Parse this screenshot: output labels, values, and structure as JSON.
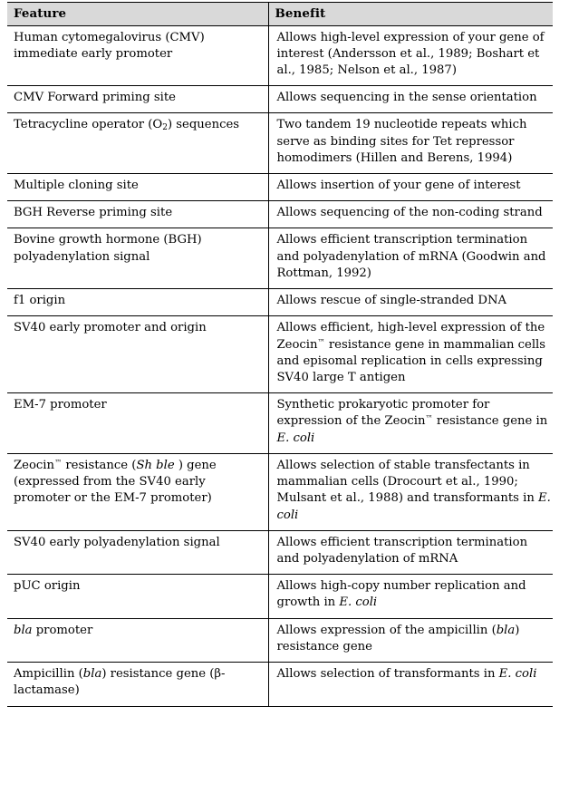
{
  "document": {
    "type": "table",
    "title": "Feature / Benefit table",
    "header_background": "#d9d9d9",
    "text_color": "#000000",
    "page_background": "#ffffff"
  },
  "table": {
    "columns": [
      {
        "key": "feature",
        "label": "Feature"
      },
      {
        "key": "benefit",
        "label": "Benefit"
      }
    ],
    "rows": [
      {
        "feature_plain": "Human cytomegalovirus (CMV) immediate early promoter",
        "feature_html": "Human cytomegalovirus (CMV) immediate early promoter",
        "benefit_plain": "Allows high-level expression of your gene of interest (Andersson et al., 1989; Boshart et al., 1985; Nelson et al., 1987)",
        "benefit_html": "Allows high-level expression of your gene of interest (Andersson et al., 1989; Boshart et al., 1985; Nelson et al., 1987)"
      },
      {
        "feature_plain": "CMV Forward priming site",
        "feature_html": "CMV Forward priming site",
        "benefit_plain": "Allows sequencing in the sense orientation",
        "benefit_html": "Allows sequencing in the sense orientation"
      },
      {
        "feature_plain": "Tetracycline operator (O2) sequences",
        "feature_html": "Tetracycline operator (O<sub class=\"sb\">2</sub>) sequences",
        "benefit_plain": "Two tandem 19 nucleotide repeats which serve as binding sites for Tet repressor homodimers (Hillen and Berens, 1994)",
        "benefit_html": "Two tandem 19 nucleotide repeats which serve as binding sites for Tet repressor homodimers (Hillen and Berens, 1994)"
      },
      {
        "feature_plain": "Multiple cloning site",
        "feature_html": "Multiple cloning site",
        "benefit_plain": "Allows insertion of your gene of interest",
        "benefit_html": "Allows insertion of your gene of interest"
      },
      {
        "feature_plain": "BGH Reverse priming site",
        "feature_html": "BGH Reverse priming site",
        "benefit_plain": "Allows sequencing of the non-coding strand",
        "benefit_html": "Allows sequencing of the non-coding strand"
      },
      {
        "feature_plain": "Bovine growth hormone (BGH) polyadenylation signal",
        "feature_html": "Bovine growth hormone (BGH) polyadenylation signal",
        "benefit_plain": "Allows efficient transcription termination and polyadenylation of mRNA (Goodwin and Rottman, 1992)",
        "benefit_html": "Allows efficient transcription termination and polyadenylation of mRNA (Goodwin and Rottman, 1992)"
      },
      {
        "feature_plain": "f1 origin",
        "feature_html": "f1 origin",
        "benefit_plain": "Allows rescue of single-stranded DNA",
        "benefit_html": "Allows rescue of single-stranded DNA"
      },
      {
        "feature_plain": "SV40 early promoter and origin",
        "feature_html": "SV40 early promoter and origin",
        "benefit_plain": "Allows efficient, high-level expression of the Zeocin™ resistance gene in mammalian cells and episomal replication in cells expressing SV40 large T antigen",
        "benefit_html": "Allows efficient, high-level expression of the Zeocin<sup class=\"tm\">™</sup> resistance gene in mammalian cells and episomal replication in cells expressing SV40 large T antigen"
      },
      {
        "feature_plain": "EM-7 promoter",
        "feature_html": "EM-7 promoter",
        "benefit_plain": "Synthetic prokaryotic promoter for expression of the Zeocin™ resistance gene in E. coli",
        "benefit_html": "Synthetic prokaryotic promoter for expression of the Zeocin<sup class=\"tm\">™</sup> resistance gene in <span class=\"it\">E. coli</span>"
      },
      {
        "feature_plain": "Zeocin™ resistance (Sh ble ) gene (expressed from the SV40 early promoter or the EM-7 promoter)",
        "feature_html": "Zeocin<sup class=\"tm\">™</sup> resistance (<span class=\"it\">Sh ble </span>) gene (expressed from the SV40 early promoter or the EM-7 promoter)",
        "benefit_plain": "Allows selection of stable transfectants in mammalian cells (Drocourt et al., 1990; Mulsant et al., 1988) and transformants in E. coli",
        "benefit_html": "Allows selection of stable transfectants in mammalian cells (Drocourt et al., 1990; Mulsant et al., 1988) and transformants in <span class=\"it\">E. coli</span>"
      },
      {
        "feature_plain": "SV40 early polyadenylation signal",
        "feature_html": "SV40 early polyadenylation signal",
        "benefit_plain": "Allows efficient transcription termination and polyadenylation of mRNA",
        "benefit_html": "Allows efficient transcription termination and polyadenylation of mRNA"
      },
      {
        "feature_plain": "pUC origin",
        "feature_html": "pUC origin",
        "benefit_plain": "Allows high-copy number replication and growth in E. coli",
        "benefit_html": "Allows high-copy number replication and growth in <span class=\"it\">E. coli</span>"
      },
      {
        "feature_plain": "bla promoter",
        "feature_html": "<span class=\"it\">bla</span> promoter",
        "benefit_plain": "Allows expression of the ampicillin (bla) resistance gene",
        "benefit_html": "Allows expression of the ampicillin (<span class=\"it\">bla</span>) resistance gene"
      },
      {
        "feature_plain": "Ampicillin (bla) resistance gene (β-lactamase)",
        "feature_html": "Ampicillin (<span class=\"it\">bla</span>) resistance gene (β-lactamase)",
        "benefit_plain": "Allows selection of transformants in E. coli",
        "benefit_html": "Allows selection of transformants in <span class=\"it\">E. </span><span class=\"it\">coli</span>"
      }
    ]
  }
}
